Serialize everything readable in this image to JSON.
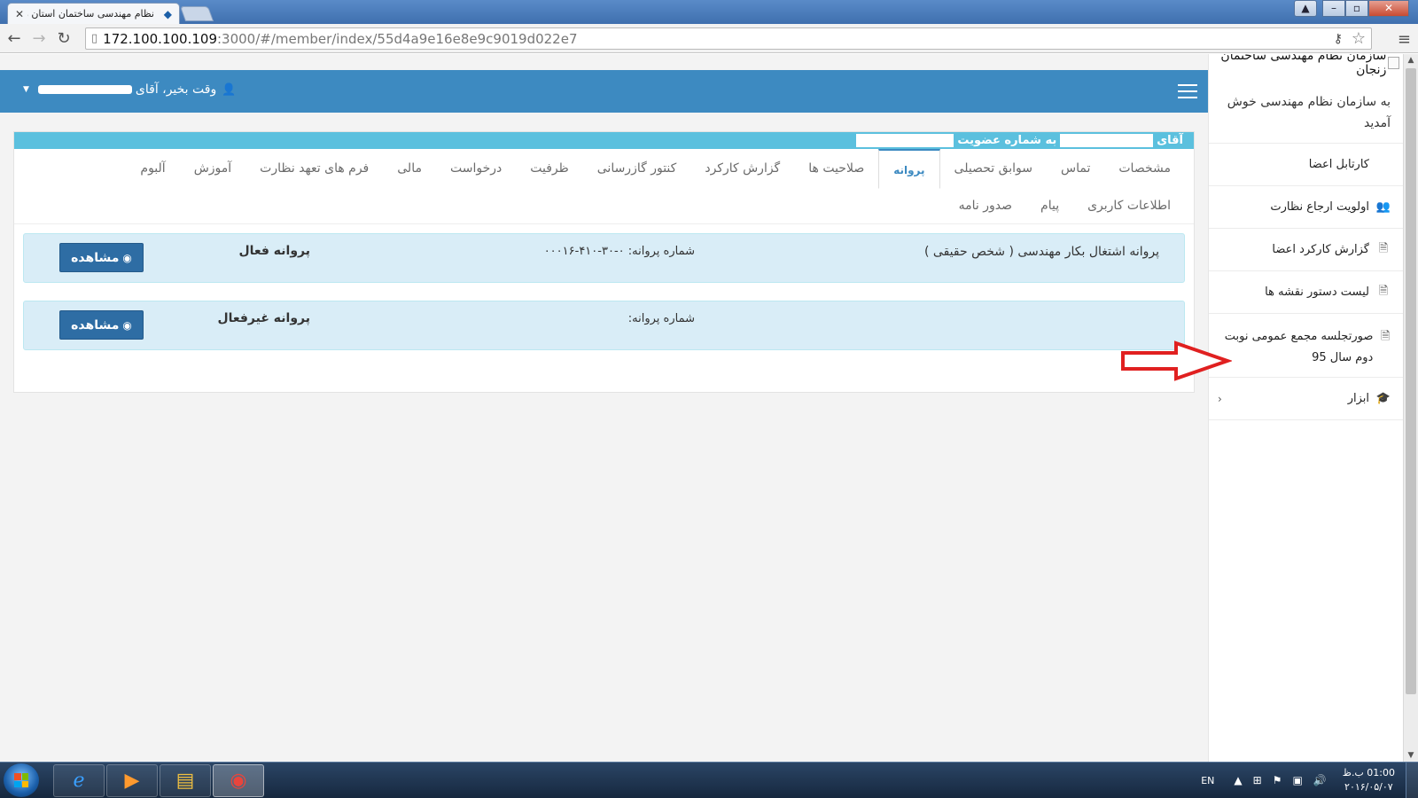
{
  "browser": {
    "tab_title": "نظام مهندسی ساختمان استان زنجان",
    "url_host": "172.100.100.109",
    "url_path": ":3000/#/member/index/55d4a9e16e8e9c9019d022e7"
  },
  "sidebar": {
    "brand": "سازمان نظام مهندسی ساختمان زنجان",
    "welcome": "به سازمان نظام مهندسی خوش آمدید",
    "items": [
      {
        "label": "کارتابل اعضا"
      },
      {
        "label": "اولویت ارجاع نظارت"
      },
      {
        "label": "گزارش کارکرد اعضا"
      },
      {
        "label": "لیست دستور نقشه ها"
      },
      {
        "label": "صورتجلسه مجمع عمومی نوبت دوم سال 95"
      },
      {
        "label": "ابزار"
      }
    ]
  },
  "header": {
    "greeting": "وقت بخیر، آقای"
  },
  "panel": {
    "title_prefix": "آقای",
    "title_mid": "به شماره عضویت"
  },
  "tabs": {
    "row1": [
      "مشخصات",
      "تماس",
      "سوابق تحصیلی",
      "پروانه",
      "صلاحیت ها",
      "گزارش کارکرد",
      "کنتور گازرسانی",
      "ظرفیت",
      "درخواست",
      "مالی",
      "فرم های تعهد نظارت",
      "آموزش",
      "آلبوم"
    ],
    "active": "پروانه",
    "row2": [
      "اطلاعات کاربری",
      "پیام",
      "صدور نامه"
    ]
  },
  "licenses": [
    {
      "name": "پروانه اشتغال بکار مهندسی ( شخص حقیقی )",
      "number_text": "شماره پروانه: ۰-۳۰-۴۱۰-۰۰۰۱۶",
      "status": "پروانه فعال",
      "button": "مشاهده"
    },
    {
      "name": "",
      "number_text": "شماره پروانه:",
      "status": "پروانه غیرفعال",
      "button": "مشاهده"
    }
  ],
  "taskbar": {
    "lang": "EN",
    "time": "01:00 ب.ظ",
    "date": "۲۰۱۶/۰۵/۰۷"
  },
  "colors": {
    "header_blue": "#3d8ac1",
    "panel_cyan": "#5bc0de",
    "license_bg": "#d9edf7",
    "button_blue": "#2e6da4",
    "arrow_red": "#e02020"
  }
}
